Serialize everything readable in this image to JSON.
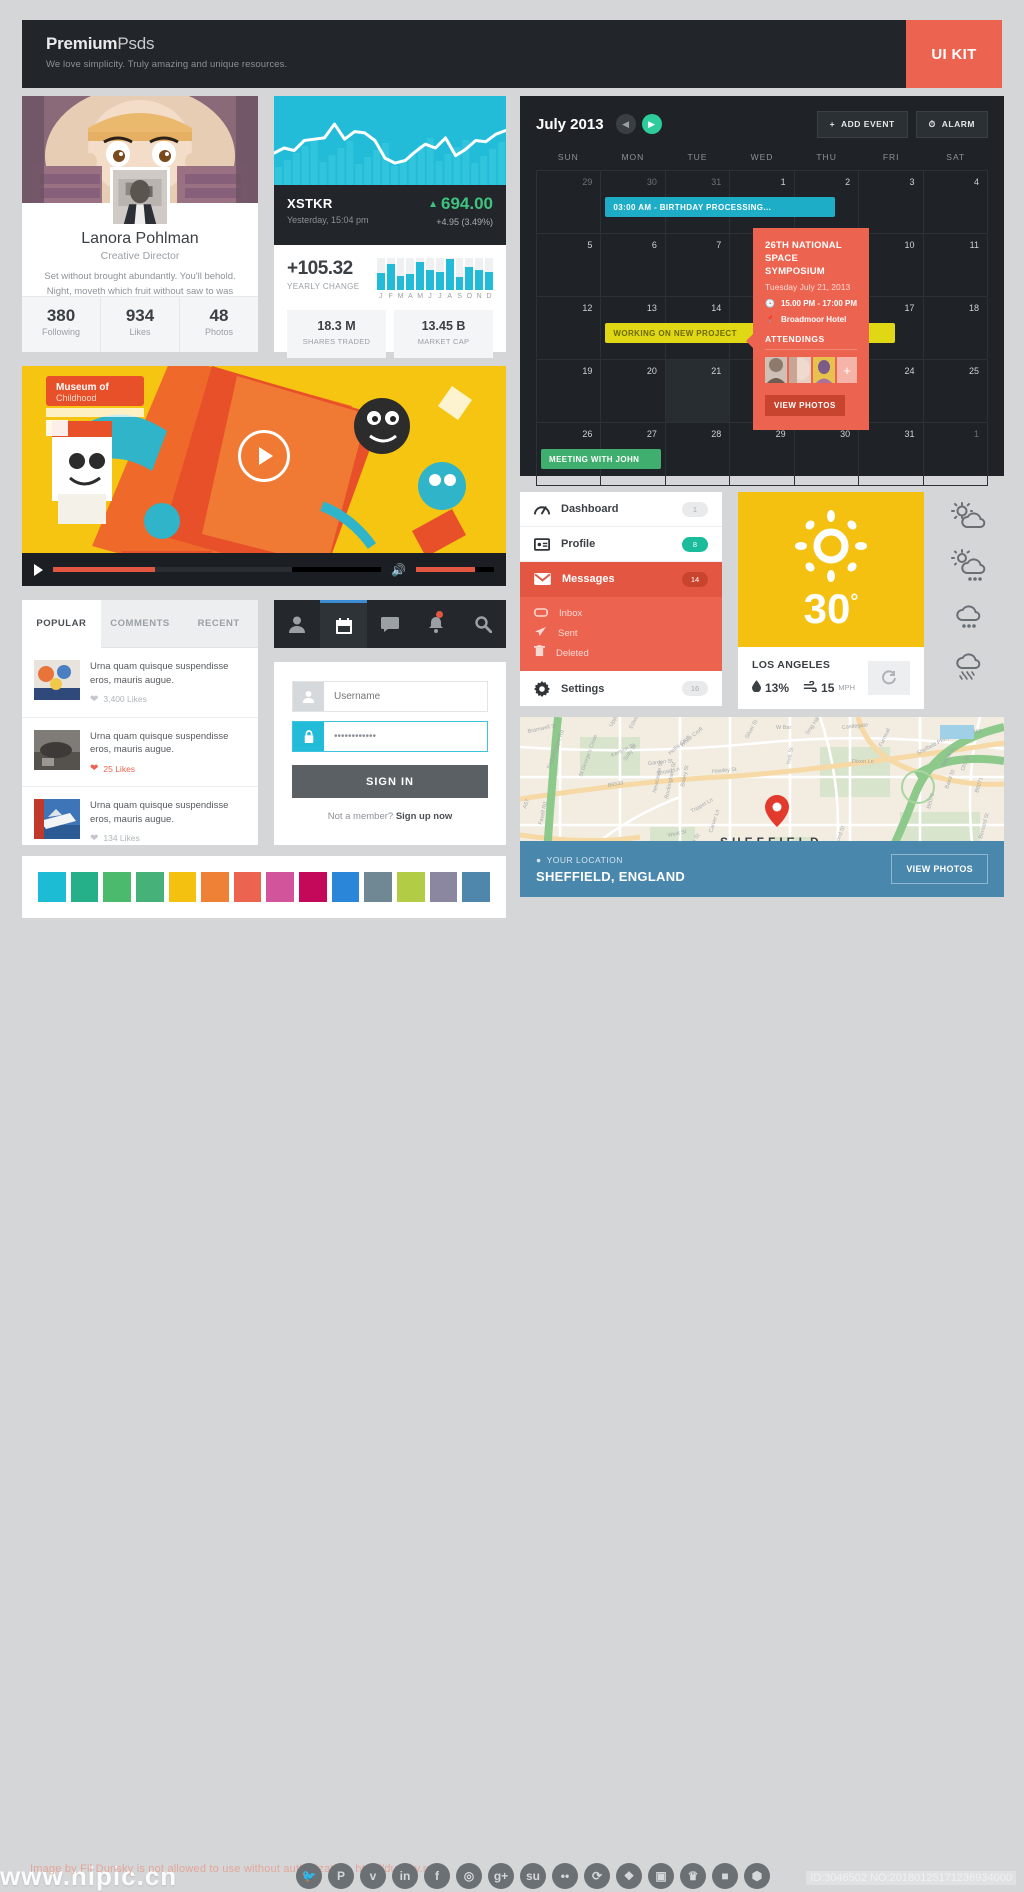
{
  "header": {
    "brand_bold": "Premium",
    "brand_light": "Psds",
    "tagline": "We love simplicity. Truly amazing and unique resources.",
    "badge": "UI KIT"
  },
  "profile": {
    "name": "Lanora Pohlman",
    "role": "Creative Director",
    "bio": "Set without brought abundantly. You'll behold. Night, moveth which fruit without saw to was rule.",
    "stats": [
      {
        "num": "380",
        "label": "Following"
      },
      {
        "num": "934",
        "label": "Likes"
      },
      {
        "num": "48",
        "label": "Photos"
      }
    ]
  },
  "stock": {
    "symbol": "XSTKR",
    "time": "Yesterday, 15:04 pm",
    "price": "694.00",
    "caret": "▲",
    "delta": "+4.95 (3.49%)",
    "yearly_value": "+105.32",
    "yearly_label": "YEARLY CHANGE",
    "months": [
      "J",
      "F",
      "M",
      "A",
      "M",
      "J",
      "J",
      "A",
      "S",
      "O",
      "N",
      "D"
    ],
    "boxes": [
      {
        "num": "18.3 M",
        "label": "SHARES TRADED"
      },
      {
        "num": "13.45 B",
        "label": "MARKET CAP"
      }
    ]
  },
  "chart_data": {
    "type": "bar",
    "title": "Yearly Change",
    "categories": [
      "J",
      "F",
      "M",
      "A",
      "M",
      "J",
      "J",
      "A",
      "S",
      "O",
      "N",
      "D"
    ],
    "values": [
      52,
      80,
      44,
      50,
      86,
      62,
      56,
      96,
      40,
      72,
      62,
      56
    ],
    "xlabel": "",
    "ylabel": "",
    "ylim": [
      0,
      100
    ],
    "series": [
      {
        "name": "Price line",
        "type": "line",
        "values": [
          38,
          46,
          42,
          58,
          60,
          62,
          84,
          60,
          72,
          70,
          58,
          30,
          22,
          26,
          40,
          52,
          46,
          62,
          34,
          44,
          58,
          56,
          68,
          74
        ]
      }
    ],
    "legend": "none",
    "grid": false
  },
  "calendar": {
    "title": "July 2013",
    "prev_icon": "chevron-left-icon",
    "next_icon": "chevron-right-icon",
    "add_event": "ADD EVENT",
    "alarm": "ALARM",
    "dows": [
      "SUN",
      "MON",
      "TUE",
      "WED",
      "THU",
      "FRI",
      "SAT"
    ],
    "weeks": [
      [
        {
          "n": "29",
          "muted": true
        },
        {
          "n": "30",
          "muted": true
        },
        {
          "n": "31",
          "muted": true
        },
        {
          "n": "1"
        },
        {
          "n": "2"
        },
        {
          "n": "3"
        },
        {
          "n": "4"
        }
      ],
      [
        {
          "n": "5"
        },
        {
          "n": "6"
        },
        {
          "n": "7"
        },
        {
          "n": "8"
        },
        {
          "n": "9"
        },
        {
          "n": "10"
        },
        {
          "n": "11"
        }
      ],
      [
        {
          "n": "12"
        },
        {
          "n": "13"
        },
        {
          "n": "14"
        },
        {
          "n": "15"
        },
        {
          "n": "16"
        },
        {
          "n": "17"
        },
        {
          "n": "18"
        }
      ],
      [
        {
          "n": "19"
        },
        {
          "n": "20"
        },
        {
          "n": "21",
          "sel": true
        },
        {
          "n": "22"
        },
        {
          "n": "23"
        },
        {
          "n": "24"
        },
        {
          "n": "25"
        }
      ],
      [
        {
          "n": "26"
        },
        {
          "n": "27"
        },
        {
          "n": "28"
        },
        {
          "n": "29"
        },
        {
          "n": "30"
        },
        {
          "n": "31"
        },
        {
          "n": "1",
          "muted": true
        }
      ]
    ],
    "events": {
      "birthday": "03:00 AM - BIRTHDAY PROCESSING...",
      "project": "WORKING ON NEW PROJECT",
      "meeting": "MEETING WITH JOHN"
    },
    "popup": {
      "title_line1": "26TH NATIONAL",
      "title_line2": "SPACE SYMPOSIUM",
      "date": "Tuesday July 21, 2013",
      "time": "15.00 PM - 17:00 PM",
      "place": "Broadmoor Hotel",
      "attendings": "ATTENDINGS",
      "plus": "+",
      "button": "VIEW PHOTOS"
    }
  },
  "video": {
    "play_icon": "play-icon",
    "volume_icon": "volume-icon",
    "poster_title": "Museum of Childhood"
  },
  "tabs_card": {
    "tabs": [
      "POPULAR",
      "COMMENTS",
      "RECENT"
    ],
    "active_tab": "POPULAR",
    "posts": [
      {
        "text": "Urna quam quisque suspendisse eros, mauris augue.",
        "likes": "3,400 Likes",
        "liked": false
      },
      {
        "text": "Urna quam quisque suspendisse eros, mauris augue.",
        "likes": "25 Likes",
        "liked": true
      },
      {
        "text": "Urna quam quisque suspendisse eros, mauris augue.",
        "likes": "134 Likes",
        "liked": false
      }
    ]
  },
  "login": {
    "nav_icons": [
      "user-icon",
      "calendar-icon",
      "chat-icon",
      "bell-icon",
      "search-icon"
    ],
    "active_nav": "calendar-icon",
    "username_placeholder": "Username",
    "username_value": "",
    "password_value": "••••••••••••",
    "sign_in": "SIGN IN",
    "signup_prefix": "Not a member? ",
    "signup_link": "Sign up now"
  },
  "menu": {
    "items": [
      {
        "label": "Dashboard",
        "badge": "1",
        "icon": "speedometer-icon",
        "state": "normal"
      },
      {
        "label": "Profile",
        "badge": "8",
        "icon": "id-card-icon",
        "state": "green"
      },
      {
        "label": "Messages",
        "badge": "14",
        "icon": "envelope-icon",
        "state": "active"
      },
      {
        "label": "Settings",
        "badge": "16",
        "icon": "gear-icon",
        "state": "normal"
      }
    ],
    "submenu": [
      {
        "label": "Inbox",
        "icon": "inbox-icon"
      },
      {
        "label": "Sent",
        "icon": "paper-plane-icon"
      },
      {
        "label": "Deleted",
        "icon": "trash-icon"
      }
    ]
  },
  "weather": {
    "icon": "sun-icon",
    "temperature": "30",
    "degree": "°",
    "city": "LOS ANGELES",
    "humidity": "13%",
    "wind": "15",
    "wind_unit": "MPH",
    "refresh_icon": "refresh-icon",
    "forecast_icons": [
      "partly-cloudy-icon",
      "sun-cloud-rain-icon",
      "cloud-rain-icon",
      "cloud-snow-icon"
    ]
  },
  "map": {
    "city_label": "SHEFFIELD",
    "your_location": "YOUR LOCATION",
    "location": "SHEFFIELD, ENGLAND",
    "button": "VIEW PHOTOS",
    "pin_icon": "map-pin-icon",
    "street_labels": [
      "Bramwell St",
      "Netherthorpe Rd",
      "Kenyon St",
      "Garden St",
      "Broad Ln",
      "B6539",
      "Hollis Croft",
      "White Croft",
      "Hawley St",
      "Silver St",
      "W Bar",
      "Snig Hill",
      "Castlegate",
      "Sheffield Pkwy",
      "A61",
      "Dixon Ln",
      "Broad St",
      "Baird St",
      "B6071",
      "Bernard St",
      "South St",
      "Pond St",
      "West St",
      "Glossop Rd",
      "Division St",
      "Trippet Ln",
      "Rockingham St",
      "Bailey St",
      "Newcastle St",
      "Carver Ln",
      "York St",
      "A57",
      "Favell Rd",
      "B6070",
      "Old St",
      "Upper Alle",
      "Edward St",
      "Solly St",
      "St George's Close",
      "Furnival"
    ]
  },
  "swatches": {
    "colors": [
      "#1bbcd4",
      "#26b08a",
      "#4cba6d",
      "#46b179",
      "#f5c111",
      "#ef8136",
      "#ec6350",
      "#d2559b",
      "#c4085a",
      "#2a86d9",
      "#6f8894",
      "#b3cc45",
      "#8b87a0",
      "#4f86ab"
    ]
  },
  "footer": {
    "socials": [
      "twitter",
      "pinterest",
      "vimeo",
      "linkedin",
      "facebook",
      "dribbble",
      "google-plus",
      "stumbleupon",
      "flickr",
      "rss",
      "dropbox",
      "instagram",
      "trophy",
      "camera",
      "behance"
    ],
    "watermark": "Image by Fil Dunsky is not allowed to use without authorization. http://dunsky.ru",
    "watermark_site": "www.nipic.cn",
    "id_tag": "ID:3046502 NO:20180125171236934000"
  }
}
